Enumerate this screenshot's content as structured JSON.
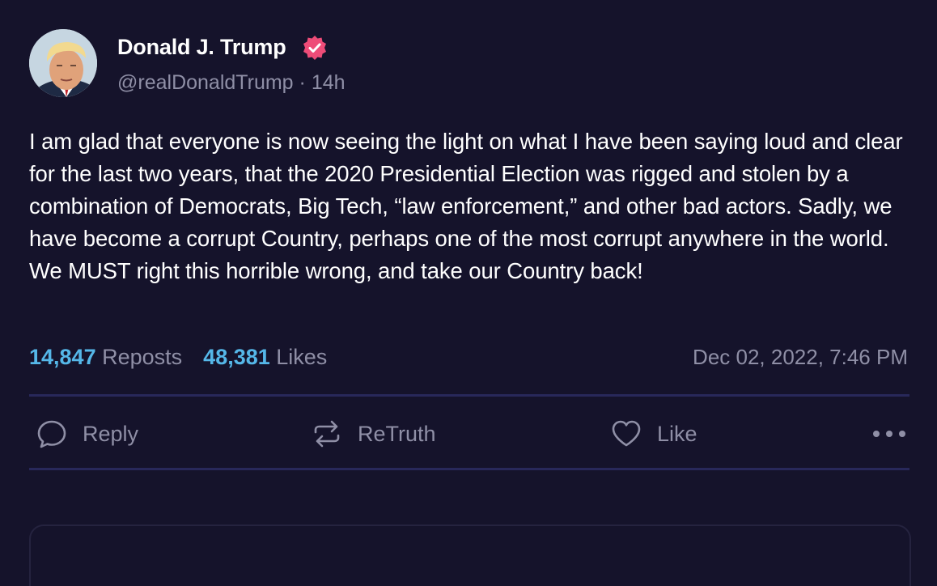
{
  "author": {
    "display_name": "Donald J. Trump",
    "handle": "@realDonaldTrump",
    "separator": "·",
    "age": "14h",
    "verified_icon": "verified-badge-icon"
  },
  "post": {
    "text": "I am glad that everyone is now seeing the light on what I have been saying loud and clear for the last two years, that the 2020 Presidential Election was rigged and stolen by a combination of Democrats, Big Tech, “law enforcement,” and other bad actors. Sadly, we have become a corrupt Country, perhaps one of the most corrupt anywhere in the world. We MUST right this horrible wrong, and take our Country back!",
    "timestamp": "Dec 02, 2022, 7:46 PM"
  },
  "stats": {
    "reposts_count": "14,847",
    "reposts_label": "Reposts",
    "likes_count": "48,381",
    "likes_label": "Likes"
  },
  "actions": {
    "reply_label": "Reply",
    "retruth_label": "ReTruth",
    "like_label": "Like",
    "more_icon": "more-horizontal-icon"
  },
  "colors": {
    "background": "#15132b",
    "accent": "#55b7e8",
    "verified": "#ee4c78",
    "muted_text": "#8f8fa6",
    "divider": "#28285a"
  }
}
